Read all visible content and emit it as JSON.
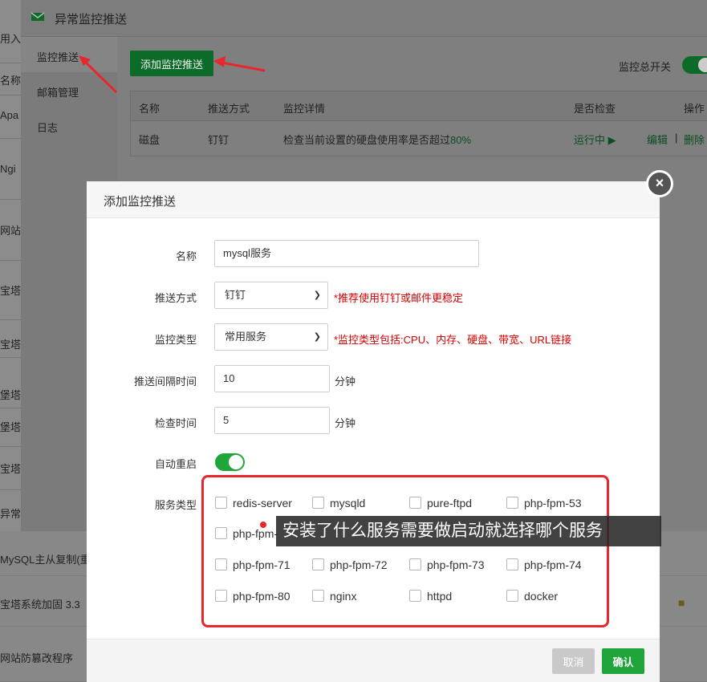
{
  "background": {
    "left_fragments": [
      "用入",
      "名称",
      "Apa",
      "Ngi",
      "网站",
      "宝塔",
      "宝塔",
      "堡塔",
      "堡塔",
      "宝塔",
      "异常"
    ],
    "bottom_rows": [
      "MySQL主从复制(重",
      "宝塔系统加固 3.3",
      "网站防篡改程序"
    ]
  },
  "window": {
    "title": "异常监控推送",
    "sidebar": [
      "监控推送",
      "邮箱管理",
      "日志"
    ],
    "add_button": "添加监控推送",
    "master_switch_label": "监控总开关",
    "master_switch_on": true,
    "table": {
      "headers": [
        "名称",
        "推送方式",
        "监控详情",
        "是否检查",
        "操作"
      ],
      "row": {
        "name": "磁盘",
        "method": "钉钉",
        "detail": "检查当前设置的硬盘使用率是否超过",
        "detail_pct": "80%",
        "status": "运行中 ▶",
        "edit": "编辑",
        "sep": "|",
        "delete": "删除"
      }
    }
  },
  "modal": {
    "title": "添加监控推送",
    "close": "×",
    "fields": {
      "name_label": "名称",
      "name_value": "mysql服务",
      "push_label": "推送方式",
      "push_value": "钉钉",
      "push_hint": "*推荐使用钉钉或邮件更稳定",
      "type_label": "监控类型",
      "type_value": "常用服务",
      "type_hint": "*监控类型包括:CPU、内存、硬盘、带宽、URL链接",
      "interval_label": "推送间隔时间",
      "interval_value": "10",
      "interval_unit": "分钟",
      "check_label": "检查时间",
      "check_value": "5",
      "check_unit": "分钟",
      "restart_label": "自动重启",
      "restart_on": true,
      "services_label": "服务类型"
    },
    "services": [
      "redis-server",
      "mysqld",
      "pure-ftpd",
      "php-fpm-53",
      "php-fpm-",
      "php-fpm-71",
      "php-fpm-72",
      "php-fpm-73",
      "php-fpm-74",
      "php-fpm-80",
      "nginx",
      "httpd",
      "docker"
    ],
    "cancel": "取消",
    "confirm": "确认"
  },
  "caption": "安装了什么服务需要做启动就选择哪个服务",
  "colors": {
    "accent": "#20a53a",
    "hint": "#d40000",
    "annotation": "#e8262c"
  }
}
